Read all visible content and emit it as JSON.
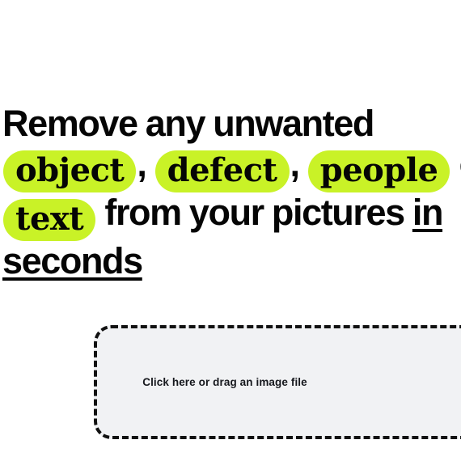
{
  "page": {
    "background_color": "#ffffff",
    "accent_highlight_color": "#c9f227",
    "text_color": "#050505"
  },
  "hero": {
    "line1": "Remove any unwanted",
    "highlight_1": "object",
    "comma_1": ",",
    "highlight_2": "defect",
    "comma_2": ",",
    "highlight_3": "people",
    "connector": "or",
    "highlight_4": "text",
    "tail": "from your pictures",
    "underlined_1": "in",
    "underlined_2": "seconds",
    "full_text": "Remove any unwanted object, defect, people or text from your pictures in seconds"
  },
  "dropzone": {
    "label": "Click here or drag an image file",
    "background_color": "#f1f2f4",
    "border_color": "#111111",
    "border_style": "dashed"
  }
}
